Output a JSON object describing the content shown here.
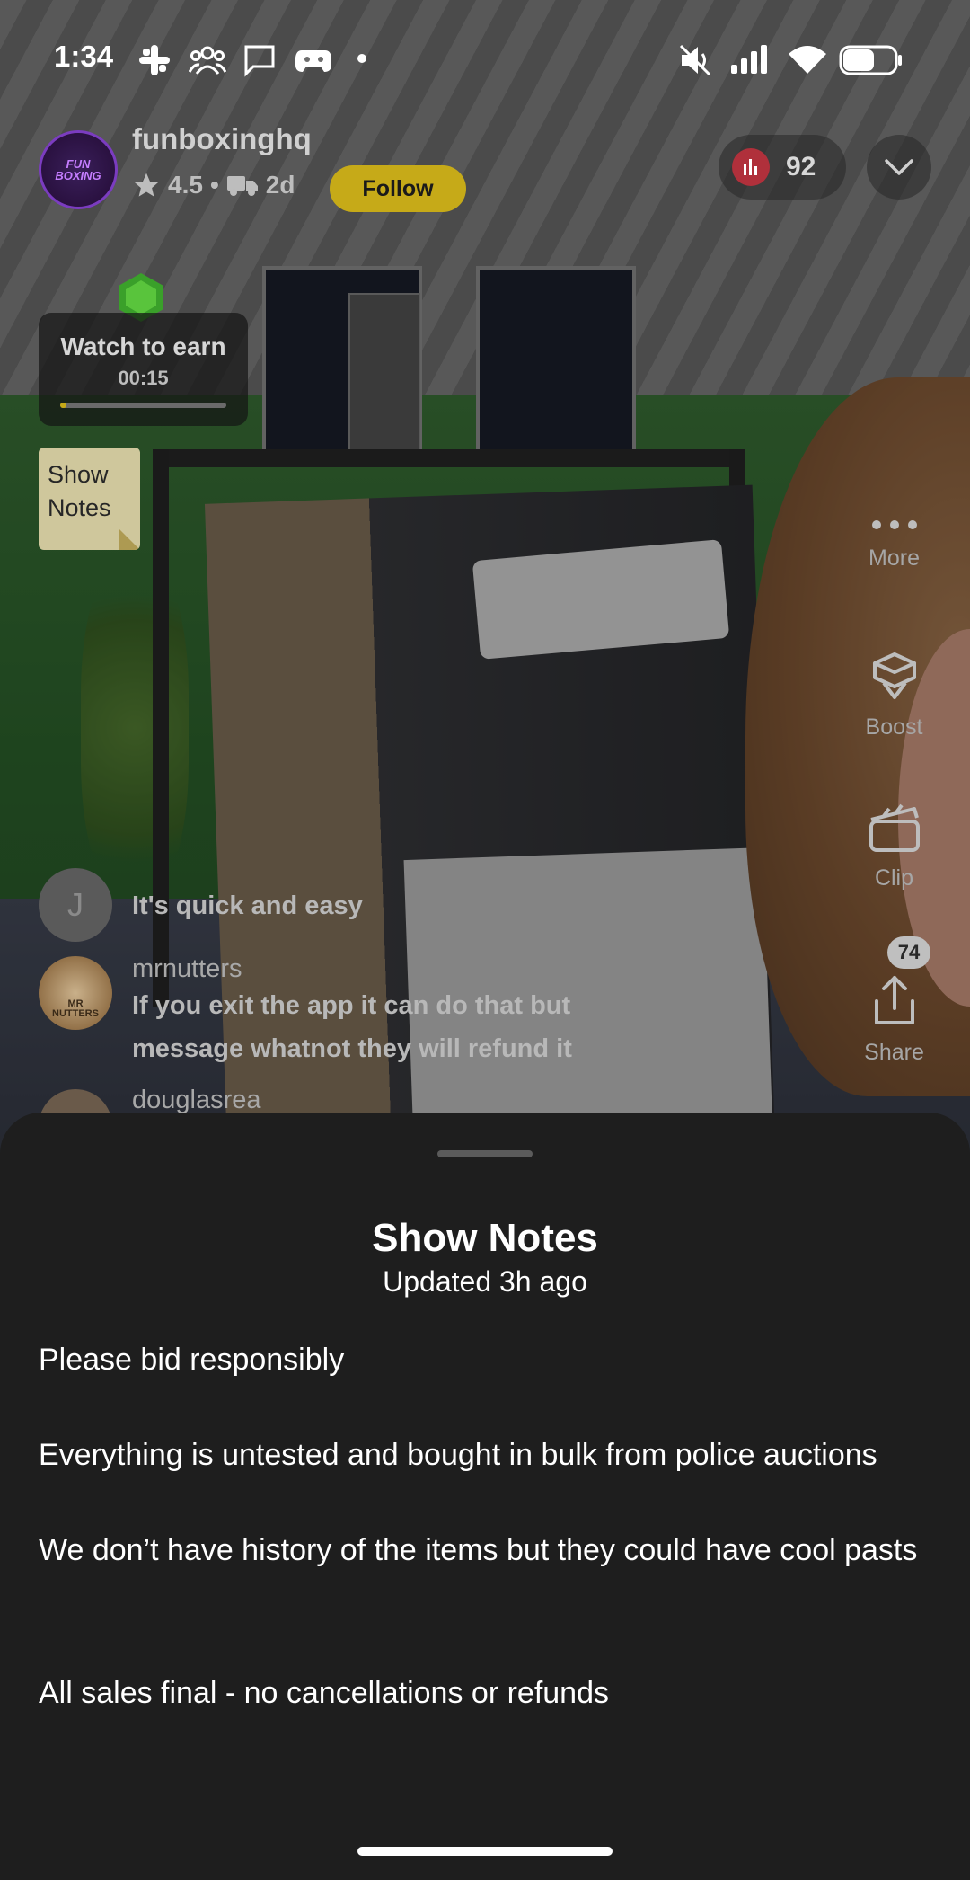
{
  "status_bar": {
    "time": "1:34"
  },
  "host": {
    "name": "funboxinghq",
    "avatar_text": [
      "FUN",
      "BOXING"
    ],
    "rating": "4.5",
    "separator": "•",
    "shipping": "2d",
    "follow_label": "Follow"
  },
  "viewers": {
    "count": "92"
  },
  "watch_to_earn": {
    "title": "Watch to earn",
    "time": "00:15",
    "progress": 0.04
  },
  "show_notes_chip": {
    "label": "Show Notes"
  },
  "right_rail": {
    "more_label": "More",
    "boost_label": "Boost",
    "clip_label": "Clip",
    "share_label": "Share",
    "share_count": "74"
  },
  "chat": {
    "messages": [
      {
        "avatar_letter": "J",
        "text": "It's quick and easy"
      },
      {
        "user": "mrnutters",
        "avatar_text": [
          "MR",
          "NUTTERS"
        ],
        "text": "If you exit the app it can do that but message whatnot they will refund it"
      },
      {
        "user": "douglasrea"
      }
    ]
  },
  "sheet": {
    "title": "Show Notes",
    "updated": "Updated 3h ago",
    "notes": [
      "Please bid responsibly",
      "Everything is untested and bought in bulk from police auctions",
      "We don’t have history of the items but they could have cool pasts",
      "All sales final - no cancellations or refunds"
    ]
  },
  "colors": {
    "follow_button": "#c6aa18",
    "sheet_background": "#1e1e1e",
    "viewer_badge": "#b0303b",
    "notes_chip": "#cfc79c"
  },
  "icons": [
    "slack-icon",
    "group-icon",
    "message-icon",
    "game-controller-icon",
    "mute-icon",
    "signal-icon",
    "wifi-icon",
    "battery-icon",
    "star-icon",
    "truck-icon",
    "bar-chart-icon",
    "chevron-down-icon",
    "gem-icon",
    "more-icon",
    "boost-icon",
    "clip-icon",
    "share-icon"
  ]
}
